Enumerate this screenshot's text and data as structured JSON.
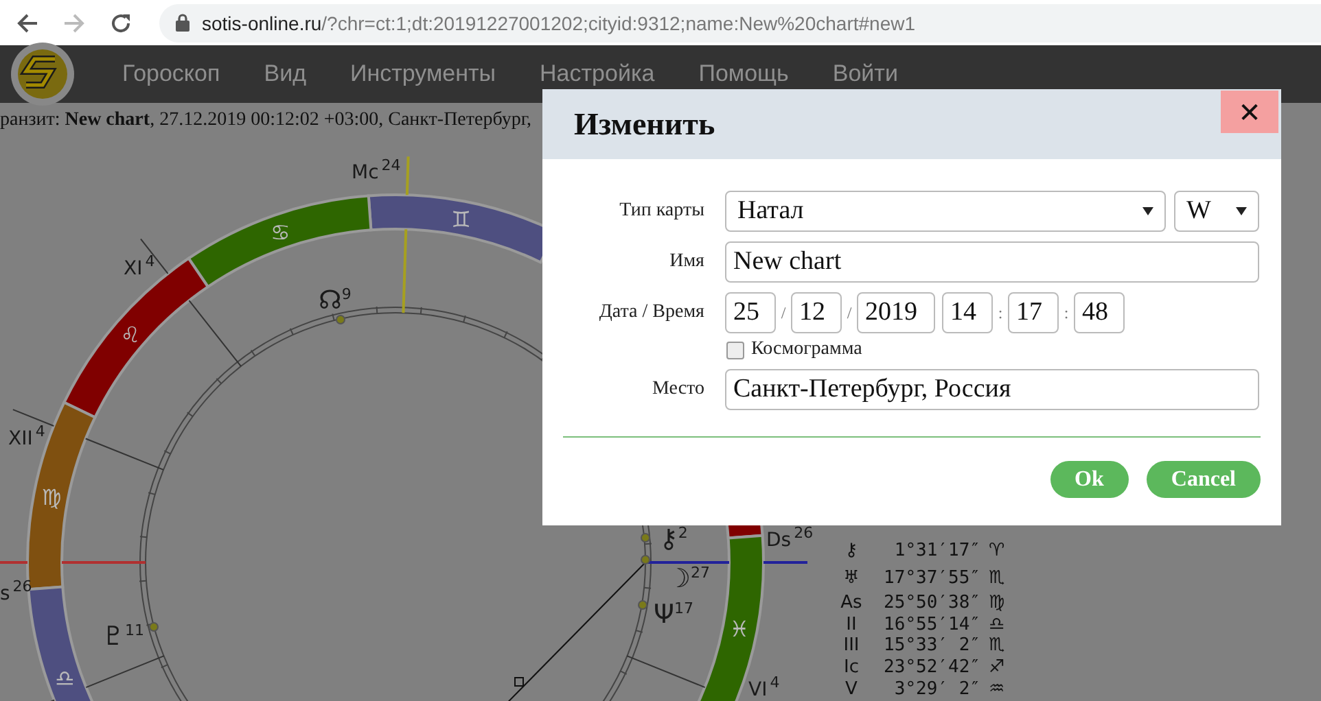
{
  "browser": {
    "url_host": "sotis-online.ru",
    "url_rest": "/?chr=ct:1;dt:20191227001202;cityid:9312;name:New%20chart#new1"
  },
  "menu": [
    "Гороскоп",
    "Вид",
    "Инструменты",
    "Настройка",
    "Помощь",
    "Войти"
  ],
  "transit_line": "ранзит: **New chart**, 27.12.2019 00:12:02 +03:00, Санкт-Петербург,",
  "chart": {
    "signs": [
      {
        "color": "#800000"
      },
      {
        "color": "#4e4f80",
        "glyph": "♊"
      },
      {
        "color": "#2e6600",
        "glyph": "♋"
      },
      {
        "color": "#800000",
        "glyph": "♌"
      },
      {
        "color": "#7f5010",
        "glyph": "♍"
      },
      {
        "color": "#4e4f80",
        "glyph": "♎"
      },
      {
        "color": "#2e6600",
        "glyph": "♓"
      }
    ],
    "house_labels": [
      {
        "label": "Mc",
        "degree": "24"
      },
      {
        "label": "XI",
        "degree": "4"
      },
      {
        "label": "XII",
        "degree": "4"
      },
      {
        "label": "s",
        "degree": "26"
      },
      {
        "label": "Ds",
        "degree": "26"
      },
      {
        "label": "VI",
        "degree": "4"
      }
    ],
    "planets": [
      {
        "glyph": "☊",
        "degree": "9"
      },
      {
        "glyph": "♇",
        "degree": "11"
      },
      {
        "glyph": "⚷",
        "degree": "2"
      },
      {
        "glyph": "☽",
        "degree": "27"
      },
      {
        "glyph": "Ψ",
        "degree": "17"
      }
    ]
  },
  "positions_table": [
    {
      "body": "⚷",
      "position": "1°31′17″",
      "sign": "♈"
    },
    {
      "body": "♅",
      "position": "17°37′55″",
      "sign": "♏"
    },
    {
      "body": "As",
      "position": "25°50′38″",
      "sign": "♍"
    },
    {
      "body": "II",
      "position": "16°55′14″",
      "sign": "♎"
    },
    {
      "body": "III",
      "position": "15°33′ 2″",
      "sign": "♏"
    },
    {
      "body": "Ic",
      "position": "23°52′42″",
      "sign": "♐"
    },
    {
      "body": "V",
      "position": "3°29′ 2″",
      "sign": "♒"
    }
  ],
  "dialog": {
    "title": "Изменить",
    "close_label": "✕",
    "chart_type": {
      "label": "Тип карты",
      "value": "Натал",
      "variant": "W"
    },
    "name": {
      "label": "Имя",
      "value": "New chart"
    },
    "datetime": {
      "label": "Дата / Время",
      "date": [
        "25",
        "12",
        "2019"
      ],
      "date_separators": [
        "/",
        "/"
      ],
      "time": [
        "14",
        "17",
        "48"
      ],
      "time_separators": [
        ":",
        ":"
      ]
    },
    "cosmogram": {
      "label": "Космограмма",
      "checked": false
    },
    "place": {
      "label": "Место",
      "value": "Санкт-Петербург, Россия"
    },
    "buttons": [
      {
        "label": "Ok"
      },
      {
        "label": "Cancel"
      }
    ]
  }
}
